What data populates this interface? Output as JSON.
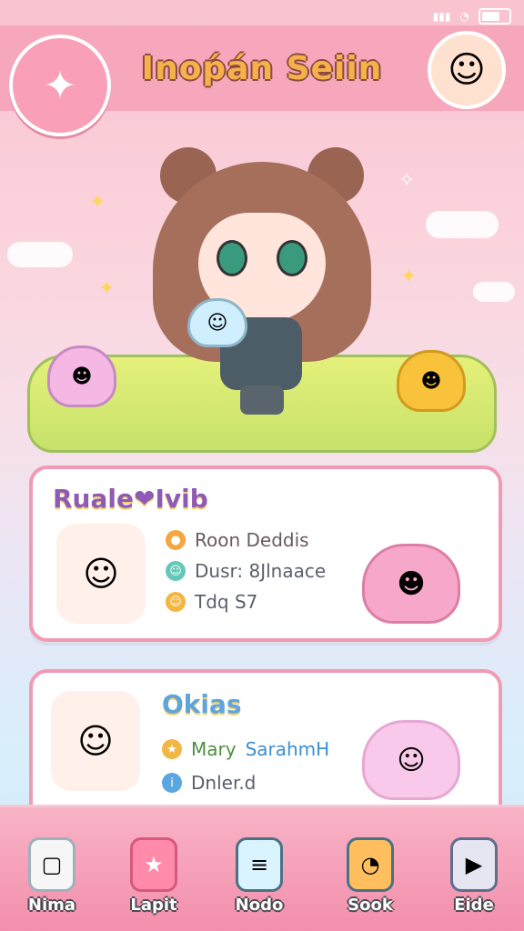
{
  "header": {
    "title": "Inoṕán Seiin"
  },
  "profile_cards": [
    {
      "title": "Ruale❤Ivib",
      "lines": [
        {
          "icon": "circle-icon",
          "text": "Roon Deddis"
        },
        {
          "icon": "smile-icon",
          "text": "Dusr: 8Jlnaace"
        },
        {
          "icon": "emoji-icon",
          "text": "Tdq S7"
        }
      ]
    },
    {
      "title": "Okias",
      "lines": [
        {
          "icon": "star-icon",
          "text": "Mary",
          "text2": "SarahmH"
        },
        {
          "icon": "info-icon",
          "text": "Dnler.d"
        }
      ]
    }
  ],
  "nav": [
    {
      "label": "Nima",
      "icon": "chat-icon"
    },
    {
      "label": "Lapit",
      "icon": "star-icon"
    },
    {
      "label": "Nodo",
      "icon": "menu-icon"
    },
    {
      "label": "Sook",
      "icon": "bag-icon"
    },
    {
      "label": "Eide",
      "icon": "play-icon"
    }
  ],
  "colors": {
    "header": "#f7a7bb",
    "card_border": "#f19ab4",
    "nav": "#f38fac"
  }
}
